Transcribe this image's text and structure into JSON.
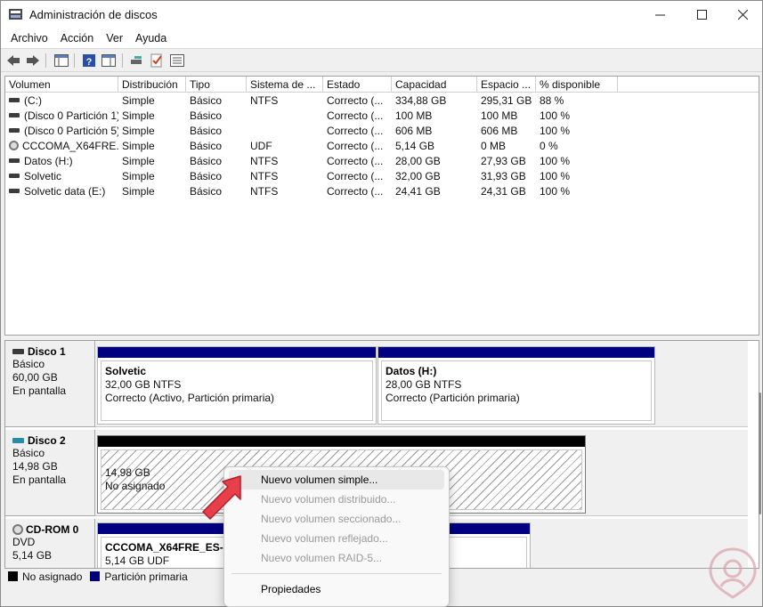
{
  "window": {
    "title": "Administración de discos"
  },
  "menu": [
    "Archivo",
    "Acción",
    "Ver",
    "Ayuda"
  ],
  "columns": [
    "Volumen",
    "Distribución",
    "Tipo",
    "Sistema de ...",
    "Estado",
    "Capacidad",
    "Espacio ...",
    "% disponible"
  ],
  "volumes": [
    {
      "name": "(C:)",
      "icon": "disk",
      "layout": "Simple",
      "type": "Básico",
      "fs": "NTFS",
      "status": "Correcto (...",
      "capacity": "334,88 GB",
      "free": "295,31 GB",
      "pct": "88 %"
    },
    {
      "name": "(Disco 0 Partición 1)",
      "icon": "disk",
      "layout": "Simple",
      "type": "Básico",
      "fs": "",
      "status": "Correcto (...",
      "capacity": "100 MB",
      "free": "100 MB",
      "pct": "100 %"
    },
    {
      "name": "(Disco 0 Partición 5)",
      "icon": "disk",
      "layout": "Simple",
      "type": "Básico",
      "fs": "",
      "status": "Correcto (...",
      "capacity": "606 MB",
      "free": "606 MB",
      "pct": "100 %"
    },
    {
      "name": "CCCOMA_X64FRE...",
      "icon": "cd",
      "layout": "Simple",
      "type": "Básico",
      "fs": "UDF",
      "status": "Correcto (...",
      "capacity": "5,14 GB",
      "free": "0 MB",
      "pct": "0 %"
    },
    {
      "name": "Datos (H:)",
      "icon": "disk",
      "layout": "Simple",
      "type": "Básico",
      "fs": "NTFS",
      "status": "Correcto (...",
      "capacity": "28,00 GB",
      "free": "27,93 GB",
      "pct": "100 %"
    },
    {
      "name": "Solvetic",
      "icon": "disk",
      "layout": "Simple",
      "type": "Básico",
      "fs": "NTFS",
      "status": "Correcto (...",
      "capacity": "32,00 GB",
      "free": "31,93 GB",
      "pct": "100 %"
    },
    {
      "name": "Solvetic data (E:)",
      "icon": "disk",
      "layout": "Simple",
      "type": "Básico",
      "fs": "NTFS",
      "status": "Correcto (...",
      "capacity": "24,41 GB",
      "free": "24,31 GB",
      "pct": "100 %"
    }
  ],
  "disks": {
    "disk1": {
      "name": "Disco 1",
      "type": "Básico",
      "size": "60,00 GB",
      "state": "En pantalla",
      "partitions": [
        {
          "title": "Solvetic",
          "size": "32,00 GB NTFS",
          "status": "Correcto (Activo, Partición primaria)"
        },
        {
          "title": "Datos  (H:)",
          "size": "28,00 GB NTFS",
          "status": "Correcto (Partición primaria)"
        }
      ]
    },
    "disk2": {
      "name": "Disco 2",
      "type": "Básico",
      "size": "14,98 GB",
      "state": "En pantalla",
      "unallocated": {
        "size": "14,98 GB",
        "label": "No asignado"
      }
    },
    "cdrom0": {
      "name": "CD-ROM 0",
      "type": "DVD",
      "size": "5,14 GB",
      "partition": {
        "title": "CCCOMA_X64FRE_ES-ES_",
        "size": "5,14 GB UDF"
      }
    }
  },
  "legend": [
    {
      "label": "No asignado",
      "color": "#000000"
    },
    {
      "label": "Partición primaria",
      "color": "#000080"
    }
  ],
  "context_menu": {
    "items": [
      {
        "label": "Nuevo volumen simple...",
        "enabled": true
      },
      {
        "label": "Nuevo volumen distribuido...",
        "enabled": false
      },
      {
        "label": "Nuevo volumen seccionado...",
        "enabled": false
      },
      {
        "label": "Nuevo volumen reflejado...",
        "enabled": false
      },
      {
        "label": "Nuevo volumen RAID-5...",
        "enabled": false
      }
    ],
    "properties": "Propiedades"
  },
  "colors": {
    "primary_partition": "#000080",
    "unallocated": "#000000",
    "arrow": "#e8404a"
  }
}
